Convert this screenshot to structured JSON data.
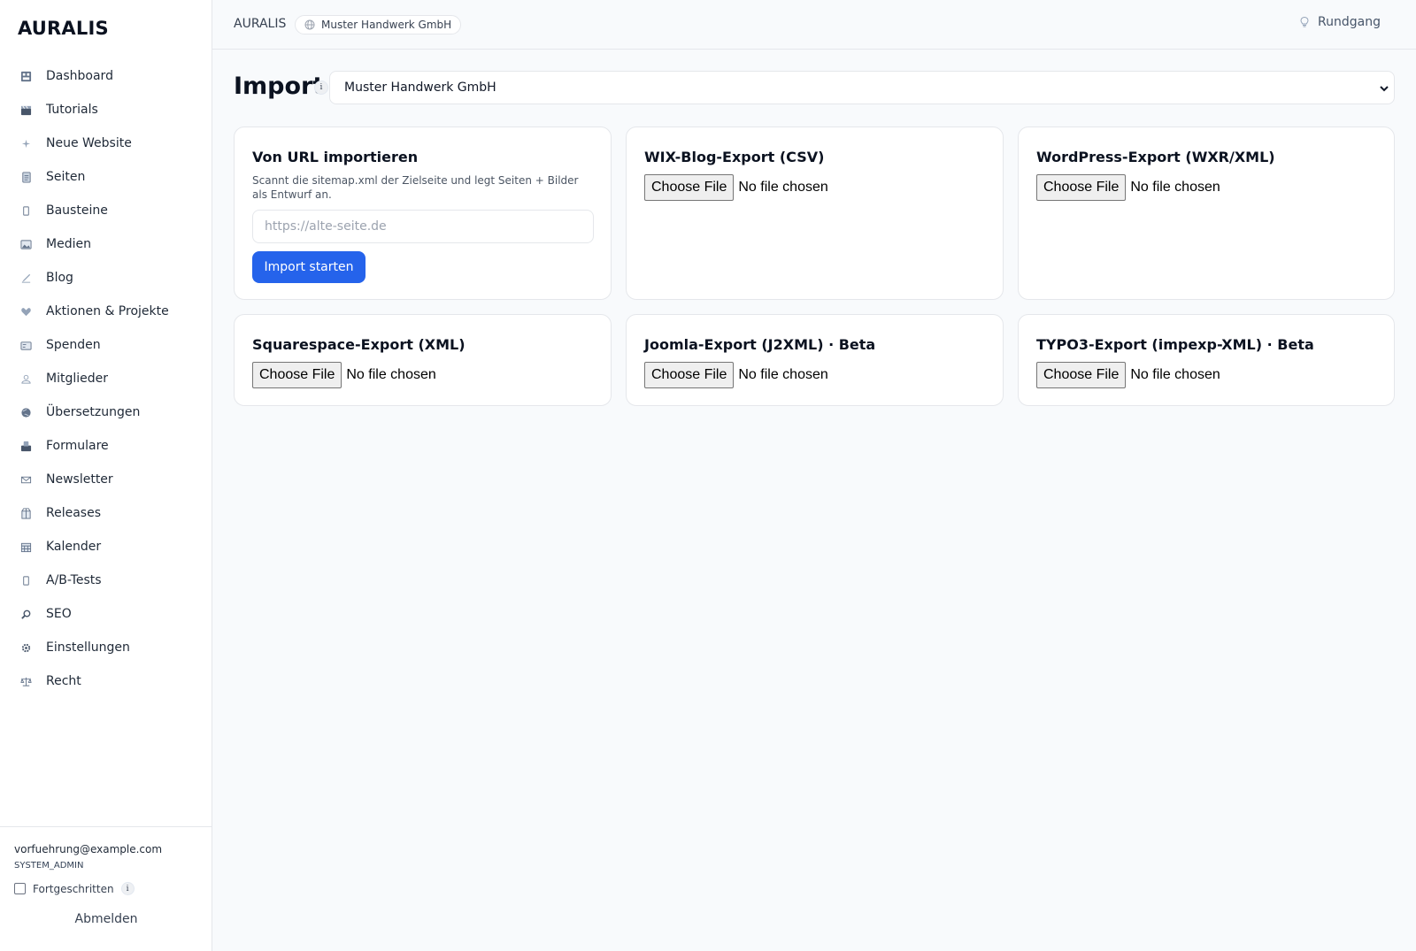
{
  "app": {
    "brand": "AURALIS"
  },
  "sidebar": {
    "items": [
      {
        "label": "Dashboard",
        "icon": "dashboard-icon"
      },
      {
        "label": "Tutorials",
        "icon": "clapper-icon"
      },
      {
        "label": "Neue Website",
        "icon": "sparkle-icon"
      },
      {
        "label": "Seiten",
        "icon": "page-icon"
      },
      {
        "label": "Bausteine",
        "icon": "block-icon"
      },
      {
        "label": "Medien",
        "icon": "image-icon"
      },
      {
        "label": "Blog",
        "icon": "pen-icon"
      },
      {
        "label": "Aktionen & Projekte",
        "icon": "heart-icon"
      },
      {
        "label": "Spenden",
        "icon": "card-icon"
      },
      {
        "label": "Mitglieder",
        "icon": "people-icon"
      },
      {
        "label": "Übersetzungen",
        "icon": "globe-icon"
      },
      {
        "label": "Formulare",
        "icon": "form-icon"
      },
      {
        "label": "Newsletter",
        "icon": "mail-icon"
      },
      {
        "label": "Releases",
        "icon": "package-icon"
      },
      {
        "label": "Kalender",
        "icon": "calendar-icon"
      },
      {
        "label": "A/B-Tests",
        "icon": "split-icon"
      },
      {
        "label": "SEO",
        "icon": "magnifier-icon"
      },
      {
        "label": "Einstellungen",
        "icon": "gear-icon"
      },
      {
        "label": "Recht",
        "icon": "scales-icon"
      }
    ],
    "user_email": "vorfuehrung@example.com",
    "user_role": "SYSTEM_ADMIN",
    "advanced_label": "Fortgeschritten",
    "advanced_checked": false,
    "info_glyph": "i",
    "logout_label": "Abmelden"
  },
  "topbar": {
    "app_name": "AURALIS",
    "site_pill": "Muster Handwerk GmbH",
    "tour_label": "Rundgang"
  },
  "main": {
    "title": "Import",
    "title_info": "i",
    "site_select_value": "Muster Handwerk GmbH",
    "url_card": {
      "title": "Von URL importieren",
      "description": "Scannt die sitemap.xml der Zielseite und legt Seiten + Bilder als Entwurf an.",
      "input_placeholder": "https://alte-seite.de",
      "button_label": "Import starten"
    },
    "file_cards": [
      {
        "title": "WIX-Blog-Export (CSV)",
        "choose_label": "Choose File",
        "status": "No file chosen"
      },
      {
        "title": "WordPress-Export (WXR/XML)",
        "choose_label": "Choose File",
        "status": "No file chosen"
      },
      {
        "title": "Squarespace-Export (XML)",
        "choose_label": "Choose File",
        "status": "No file chosen"
      },
      {
        "title": "Joomla-Export (J2XML) · Beta",
        "choose_label": "Choose File",
        "status": "No file chosen"
      },
      {
        "title": "TYPO3-Export (impexp-XML) · Beta",
        "choose_label": "Choose File",
        "status": "No file chosen"
      }
    ]
  },
  "colors": {
    "accent": "#2563eb",
    "sidebar_bg": "#ffffff",
    "page_bg": "#f8fafc",
    "border": "#e5e7eb"
  }
}
